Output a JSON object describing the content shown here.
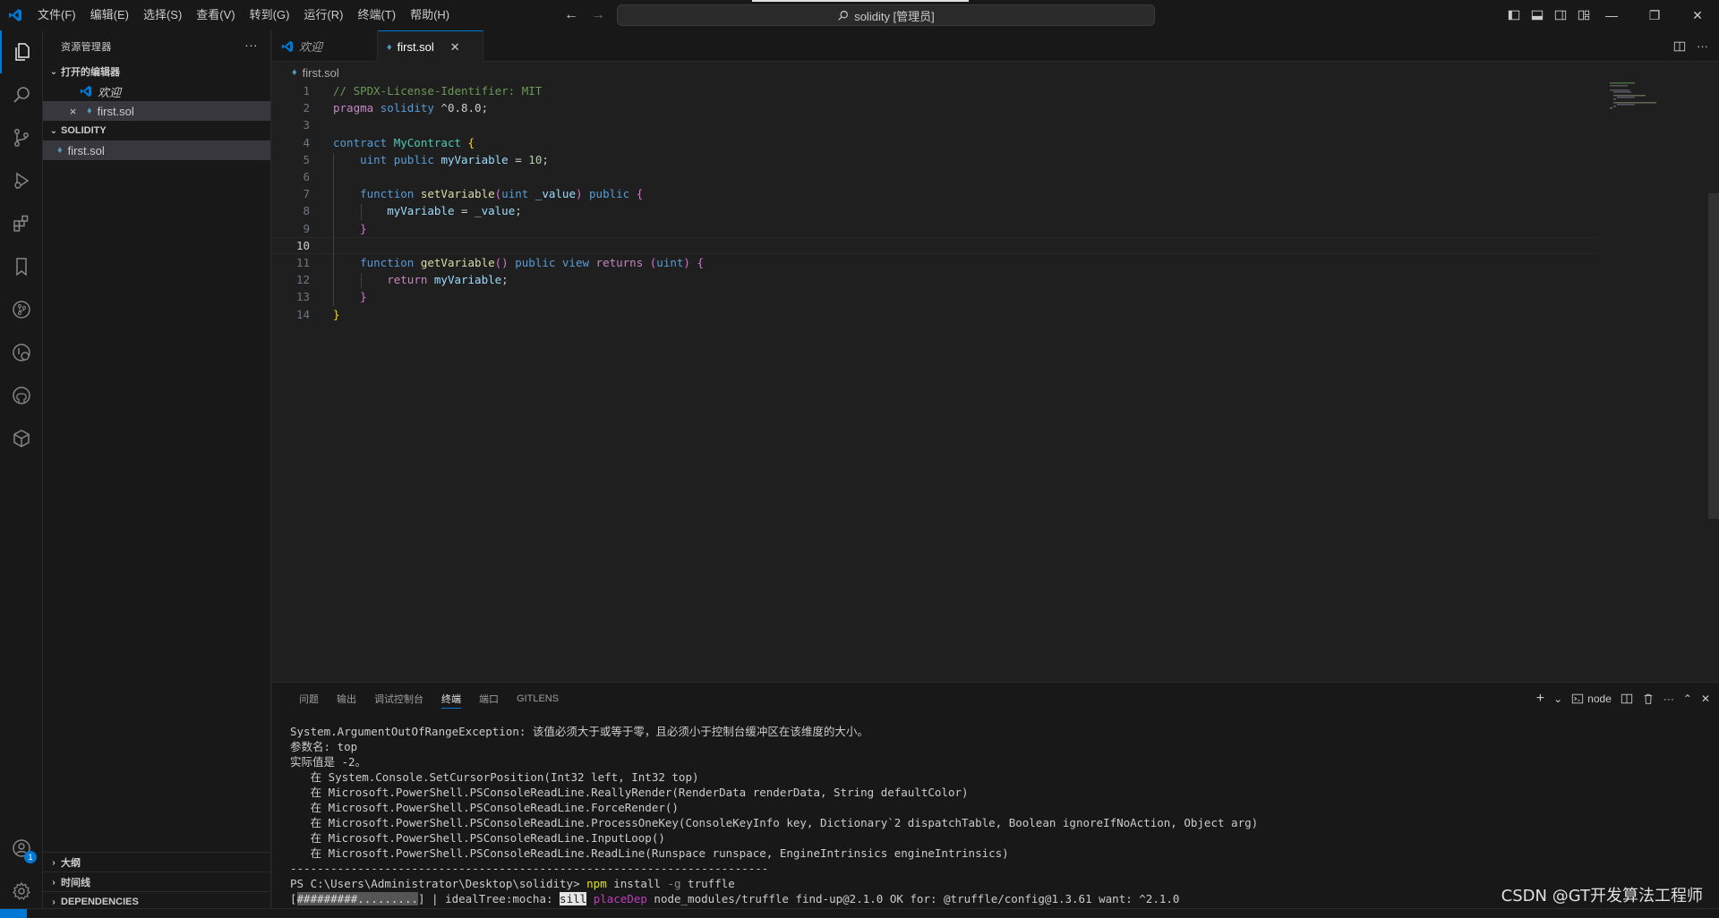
{
  "titlebar": {
    "menu": [
      "文件(F)",
      "编辑(E)",
      "选择(S)",
      "查看(V)",
      "转到(G)",
      "运行(R)",
      "终端(T)",
      "帮助(H)"
    ],
    "search_text": "solidity [管理员]"
  },
  "activity_bar": {
    "items": [
      "explorer-icon",
      "search-icon",
      "source-control-icon",
      "run-debug-icon",
      "extensions-icon",
      "bookmarks-icon",
      "git-graph-icon",
      "remote-explorer-icon",
      "github-icon",
      "package-icon"
    ],
    "accounts_badge": "1"
  },
  "sidebar": {
    "title": "资源管理器",
    "open_editors_header": "打开的编辑器",
    "open_editors": [
      {
        "label": "欢迎",
        "italic": true
      },
      {
        "label": "first.sol",
        "close": "×"
      }
    ],
    "folder_header": "SOLIDITY",
    "files": [
      "first.sol"
    ],
    "outline_header": "大纲",
    "timeline_header": "时间线",
    "dependencies_header": "DEPENDENCIES"
  },
  "tabs": [
    {
      "label": "欢迎",
      "active": false
    },
    {
      "label": "first.sol",
      "active": true
    }
  ],
  "breadcrumb": "first.sol",
  "editor": {
    "current_line": 10,
    "lines": [
      [
        [
          "// SPDX-License-Identifier: MIT",
          "comment"
        ]
      ],
      [
        [
          "pragma ",
          "ctrl"
        ],
        [
          "solidity ",
          "kw"
        ],
        [
          "^0.8.0;",
          "plain"
        ]
      ],
      [],
      [
        [
          "contract ",
          "kw"
        ],
        [
          "MyContract ",
          "type"
        ],
        [
          "{",
          "b1"
        ]
      ],
      [
        [
          "    ",
          "plain"
        ],
        [
          "uint ",
          "kw"
        ],
        [
          "public ",
          "kw"
        ],
        [
          "myVariable ",
          "var"
        ],
        [
          "= ",
          "plain"
        ],
        [
          "10",
          "num"
        ],
        [
          ";",
          "plain"
        ]
      ],
      [],
      [
        [
          "    ",
          "plain"
        ],
        [
          "function ",
          "kw"
        ],
        [
          "setVariable",
          "fn"
        ],
        [
          "(",
          "b2"
        ],
        [
          "uint ",
          "kw"
        ],
        [
          "_value",
          "var"
        ],
        [
          ") ",
          "b2"
        ],
        [
          "public ",
          "kw"
        ],
        [
          "{",
          "b2"
        ]
      ],
      [
        [
          "        ",
          "plain"
        ],
        [
          "myVariable ",
          "var"
        ],
        [
          "= ",
          "plain"
        ],
        [
          "_value",
          "var"
        ],
        [
          ";",
          "plain"
        ]
      ],
      [
        [
          "    ",
          "plain"
        ],
        [
          "}",
          "b2"
        ]
      ],
      [],
      [
        [
          "    ",
          "plain"
        ],
        [
          "function ",
          "kw"
        ],
        [
          "getVariable",
          "fn"
        ],
        [
          "() ",
          "b2"
        ],
        [
          "public ",
          "kw"
        ],
        [
          "view ",
          "kw"
        ],
        [
          "returns ",
          "ctrl"
        ],
        [
          "(",
          "b2"
        ],
        [
          "uint",
          "kw"
        ],
        [
          ") ",
          "b2"
        ],
        [
          "{",
          "b2"
        ]
      ],
      [
        [
          "        ",
          "plain"
        ],
        [
          "return ",
          "ctrl"
        ],
        [
          "myVariable",
          "var"
        ],
        [
          ";",
          "plain"
        ]
      ],
      [
        [
          "    ",
          "plain"
        ],
        [
          "}",
          "b2"
        ]
      ],
      [
        [
          "}",
          "b1"
        ]
      ]
    ]
  },
  "panel": {
    "tabs": [
      "问题",
      "输出",
      "调试控制台",
      "终端",
      "端口",
      "GITLENS"
    ],
    "active_tab": "终端",
    "terminal_name": "node",
    "terminal_lines": [
      [
        [
          "System.ArgumentOutOfRangeException: 该值必须大于或等于零，且必须小于控制台缓冲区在该维度的大小。",
          ""
        ]
      ],
      [
        [
          "参数名: top",
          ""
        ]
      ],
      [
        [
          "实际值是 -2。",
          ""
        ]
      ],
      [
        [
          "   在 System.Console.SetCursorPosition(Int32 left, Int32 top)",
          ""
        ]
      ],
      [
        [
          "   在 Microsoft.PowerShell.PSConsoleReadLine.ReallyRender(RenderData renderData, String defaultColor)",
          ""
        ]
      ],
      [
        [
          "   在 Microsoft.PowerShell.PSConsoleReadLine.ForceRender()",
          ""
        ]
      ],
      [
        [
          "   在 Microsoft.PowerShell.PSConsoleReadLine.ProcessOneKey(ConsoleKeyInfo key, Dictionary`2 dispatchTable, Boolean ignoreIfNoAction, Object arg)",
          ""
        ]
      ],
      [
        [
          "   在 Microsoft.PowerShell.PSConsoleReadLine.InputLoop()",
          ""
        ]
      ],
      [
        [
          "   在 Microsoft.PowerShell.PSConsoleReadLine.ReadLine(Runspace runspace, EngineIntrinsics engineIntrinsics)",
          ""
        ]
      ],
      [
        [
          "-----------------------------------------------------------------------",
          ""
        ]
      ],
      [
        [
          "PS C:\\Users\\Administrator\\Desktop\\solidity> ",
          ""
        ],
        [
          "npm ",
          "yellow"
        ],
        [
          "install ",
          ""
        ],
        [
          "-g ",
          "gray"
        ],
        [
          "truffle",
          ""
        ]
      ],
      [
        [
          "[",
          ""
        ],
        [
          "#########.........",
          "bar"
        ],
        [
          "] | idealTree:mocha: ",
          ""
        ],
        [
          "sill",
          "inv"
        ],
        [
          " ",
          ""
        ],
        [
          "placeDep",
          "magenta"
        ],
        [
          " node_modules/truffle find-up@2.1.0 OK for: @truffle/config@1.3.61 want: ^2.1.0",
          ""
        ]
      ]
    ]
  },
  "watermark": "CSDN @GT开发算法工程师"
}
